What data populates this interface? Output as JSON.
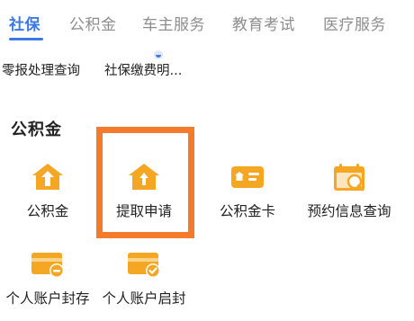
{
  "tabs": [
    {
      "label": "社保",
      "active": true
    },
    {
      "label": "公积金",
      "active": false
    },
    {
      "label": "车主服务",
      "active": false
    },
    {
      "label": "教育考试",
      "active": false
    },
    {
      "label": "医疗服务",
      "active": false
    }
  ],
  "social_security_links": [
    {
      "label": "零报处理查询"
    },
    {
      "label": "社保缴费明..."
    }
  ],
  "housing_fund": {
    "title": "公积金",
    "items": [
      {
        "label": "公积金",
        "icon": "house-up-icon"
      },
      {
        "label": "提取申请",
        "icon": "house-up-icon"
      },
      {
        "label": "公积金卡",
        "icon": "id-card-icon"
      },
      {
        "label": "预约信息查询",
        "icon": "calendar-search-icon"
      },
      {
        "label": "个人账户封存",
        "icon": "account-minus-icon"
      },
      {
        "label": "个人账户启封",
        "icon": "account-check-icon"
      }
    ],
    "highlighted_item": "提取申请"
  },
  "colors": {
    "accent": "#3b7ae6",
    "icon_orange": "#f5a623",
    "highlight": "#f57a2c",
    "inactive_tab": "#8d8d8d"
  }
}
